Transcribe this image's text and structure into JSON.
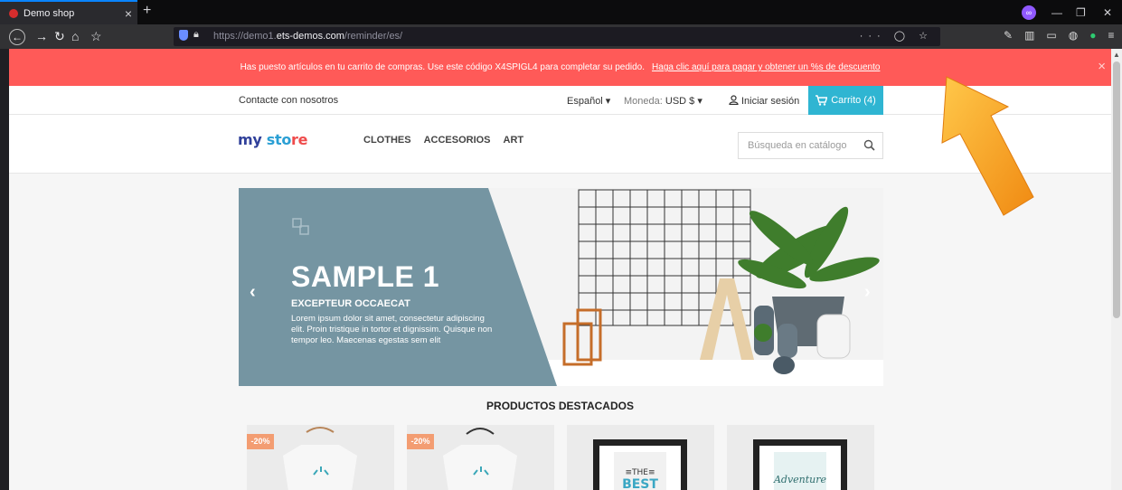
{
  "browser": {
    "tab_title": "Demo shop",
    "tab_close": "×",
    "new_tab": "+",
    "url_prefix": "https://demo1.",
    "url_host": "ets-demos.com",
    "url_path": "/reminder/es/",
    "url_actions": "··· ◯ ☆"
  },
  "promo": {
    "text": "Has puesto artículos en tu carrito de compras. Use este código X4SPIGL4 para completar su pedido.",
    "link": "Haga clic aquí para pagar y obtener un %s de descuento",
    "close": "×"
  },
  "topnav": {
    "contact": "Contacte con nosotros",
    "language": "Español ▾",
    "currency_label": "Moneda:",
    "currency_value": "USD $ ▾",
    "signin": "Iniciar sesión",
    "cart": "Carrito (4)"
  },
  "header": {
    "logo_my": "my ",
    "logo_sto": "sto",
    "logo_re": "re",
    "menu": [
      "CLOTHES",
      "ACCESORIOS",
      "ART"
    ],
    "search_placeholder": "Búsqueda en catálogo"
  },
  "slider": {
    "title": "SAMPLE 1",
    "subtitle": "EXCEPTEUR OCCAECAT",
    "body": "Lorem ipsum dolor sit amet, consectetur adipiscing elit. Proin tristique in tortor et dignissim. Quisque non tempor leo. Maecenas egestas sem elit",
    "prev": "‹",
    "next": "›",
    "panel_color": "#7595a2"
  },
  "featured_title": "PRODUCTOS DESTACADOS",
  "products": [
    {
      "badge": "-20%"
    },
    {
      "badge": "-20%"
    },
    {
      "badge": ""
    },
    {
      "badge": ""
    }
  ],
  "colors": {
    "promo": "#ff5a58",
    "cart": "#2fb5d2",
    "arrow": "#f5a21c"
  }
}
